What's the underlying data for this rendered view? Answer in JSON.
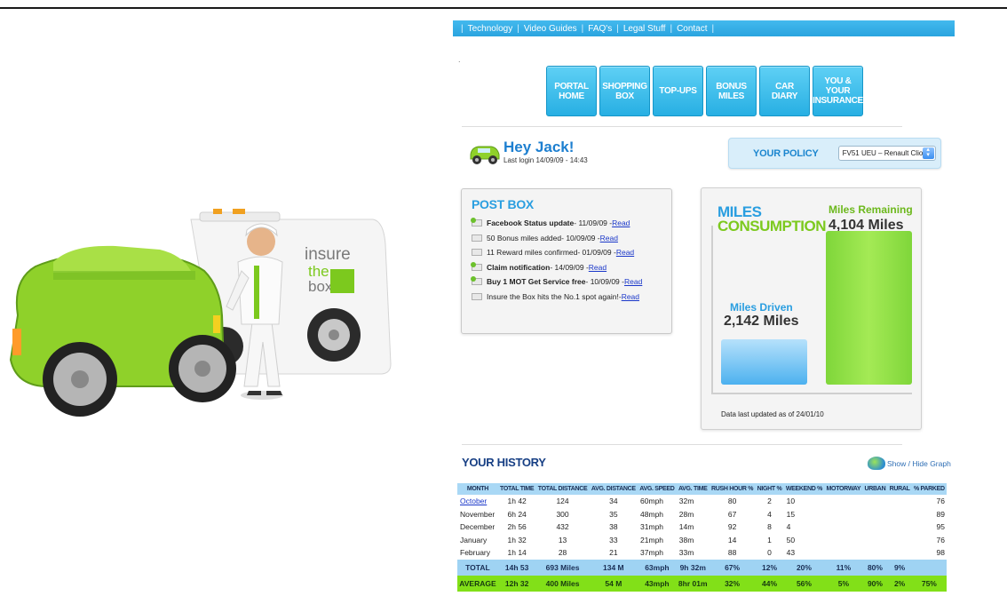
{
  "top_nav": {
    "items": [
      "Technology",
      "Video Guides",
      "FAQ's",
      "Legal Stuff",
      "Contact"
    ]
  },
  "main_nav": {
    "tiles": [
      {
        "line1": "PORTAL",
        "line2": "HOME"
      },
      {
        "line1": "SHOPPING",
        "line2": "BOX"
      },
      {
        "line1": "TOP-UPS",
        "line2": ""
      },
      {
        "line1": "BONUS",
        "line2": "MILES"
      },
      {
        "line1": "CAR DIARY",
        "line2": ""
      },
      {
        "line1": "YOU & YOUR",
        "line2": "INSURANCE"
      }
    ]
  },
  "illustration": {
    "brand_line1": "insure",
    "brand_line2": "the",
    "brand_line3": "box"
  },
  "greeting": {
    "title": "Hey Jack!",
    "last_login": "Last login 14/09/09 - 14:43"
  },
  "policy": {
    "label": "YOUR POLICY",
    "selected": "FV51 UEU – Renault Clio"
  },
  "post_box": {
    "title": "POST BOX",
    "messages": [
      {
        "text": "Facebook Status update",
        "date": " - 11/09/09 - ",
        "link": "Read",
        "unread": true
      },
      {
        "text": "50 Bonus miles added",
        "date": " - 10/09/09 - ",
        "link": "Read",
        "unread": false
      },
      {
        "text": "11 Reward miles confirmed",
        "date": "- 01/09/09 - ",
        "link": "Read",
        "unread": false
      },
      {
        "text": "Claim notification",
        "date": " - 14/09/09 - ",
        "link": "Read",
        "unread": true
      },
      {
        "text": "Buy 1 MOT Get Service free",
        "date": "- 10/09/09 - ",
        "link": "Read",
        "unread": true
      },
      {
        "text": "Insure the Box hits the No.1 spot again!",
        "date": " - ",
        "link": "Read",
        "unread": false
      }
    ]
  },
  "miles": {
    "title_line1": "MILES",
    "title_line2": "CONSUMPTION",
    "remaining_label": "Miles Remaining",
    "remaining_value": "4,104 Miles",
    "driven_label": "Miles Driven",
    "driven_value": "2,142  Miles",
    "driven_fraction": 0.2706,
    "remaining_fraction": 0.9109,
    "footer": "Data last updated as of 24/01/10"
  },
  "history": {
    "title": "YOUR HISTORY",
    "toggle_label": "Show / Hide Graph",
    "columns": [
      "MONTH",
      "TOTAL TIME",
      "TOTAL DISTANCE",
      "AVG. DISTANCE",
      "AVG. SPEED",
      "AVG. TIME",
      "RUSH HOUR %",
      "NIGHT %",
      "WEEKEND %",
      "MOTORWAY",
      "URBAN",
      "RURAL",
      "% PARKED"
    ],
    "rows": [
      [
        "October",
        "1h 42",
        "124",
        "34",
        "60mph",
        "32m",
        "80",
        "2",
        "10",
        "",
        "",
        "",
        "76"
      ],
      [
        "November",
        "6h 24",
        "300",
        "35",
        "48mph",
        "28m",
        "67",
        "4",
        "15",
        "",
        "",
        "",
        "89"
      ],
      [
        "December",
        "2h 56",
        "432",
        "38",
        "31mph",
        "14m",
        "92",
        "8",
        "4",
        "",
        "",
        "",
        "95"
      ],
      [
        "January",
        "1h 32",
        "13",
        "33",
        "21mph",
        "38m",
        "14",
        "1",
        "50",
        "",
        "",
        "",
        "76"
      ],
      [
        "February",
        "1h 14",
        "28",
        "21",
        "37mph",
        "33m",
        "88",
        "0",
        "43",
        "",
        "",
        "",
        "98"
      ]
    ],
    "total": [
      "TOTAL",
      "14h 53",
      "693 Miles",
      "134 M",
      "63mph",
      "9h 32m",
      "67%",
      "12%",
      "20%",
      "11%",
      "80%",
      "9%",
      ""
    ],
    "average": [
      "AVERAGE",
      "12h 32",
      "400 Miles",
      "54 M",
      "43mph",
      "8hr 01m",
      "32%",
      "44%",
      "56%",
      "5%",
      "90%",
      "2%",
      "75%"
    ]
  },
  "colors": {
    "brand_blue": "#2a9ee0",
    "brand_green": "#7cc91e",
    "nav_blue": "#27afe3"
  }
}
